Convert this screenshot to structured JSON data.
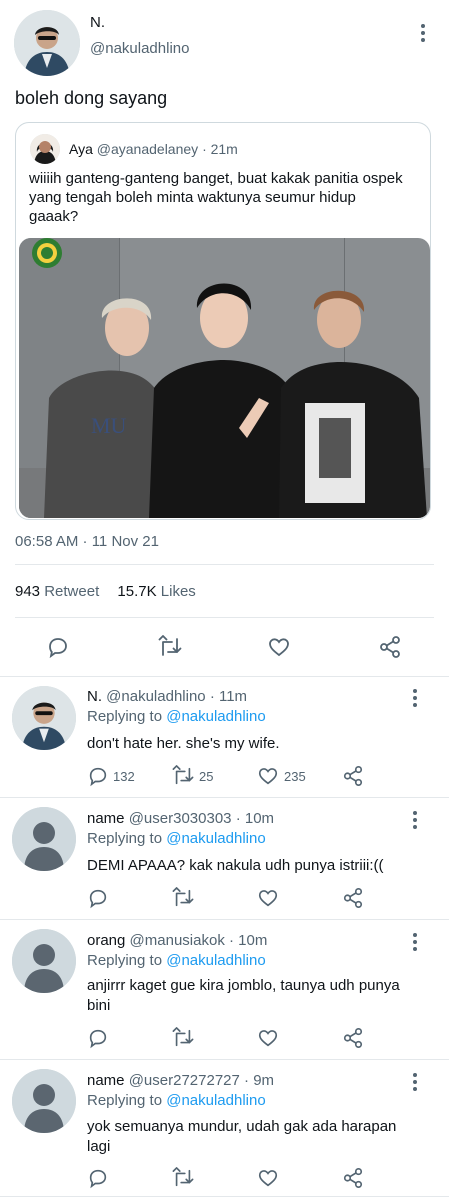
{
  "tweet": {
    "display_name": "N.",
    "handle": "@nakuladhlino",
    "text": "boleh dong sayang",
    "timestamp": "06:58 AM · 11 Nov 21",
    "retweets_count": "943",
    "retweets_label": "Retweet",
    "likes_count": "15.7K",
    "likes_label": "Likes",
    "quote": {
      "display_name": "Aya",
      "handle": "@ayanadelaney",
      "time": "· 21m",
      "text": "wiiiih ganteng-ganteng banget, buat kakak panitia ospek yang tengah boleh minta waktunya seumur hidup gaaak?"
    }
  },
  "replies": [
    {
      "display_name": "N.",
      "handle": "@nakuladhlino",
      "time": "· 11m",
      "replying_label": "Replying to",
      "replying_to": "@nakuladhlino",
      "text": "don't hate her. she's my wife.",
      "reply_count": "132",
      "retweet_count": "25",
      "like_count": "235"
    },
    {
      "display_name": "name",
      "handle": "@user3030303",
      "time": "· 10m",
      "replying_label": "Replying to",
      "replying_to": "@nakuladhlino",
      "text": "DEMI APAAA? kak nakula udh punya istriii:(("
    },
    {
      "display_name": "orang",
      "handle": "@manusiakok",
      "time": "· 10m",
      "replying_label": "Replying to",
      "replying_to": "@nakuladhlino",
      "text": "anjirrr kaget gue kira jomblo, taunya udh punya bini"
    },
    {
      "display_name": "name",
      "handle": "@user27272727",
      "time": "· 9m",
      "replying_label": "Replying to",
      "replying_to": "@nakuladhlino",
      "text": "yok semuanya mundur, udah gak ada harapan lagi"
    }
  ],
  "colors": {
    "accent": "#1d9bf0",
    "secondary_text": "#536471",
    "icon": "#536471",
    "divider": "#e4e8eb"
  },
  "icons": [
    "reply-icon",
    "retweet-icon",
    "like-icon",
    "share-icon",
    "more-icon"
  ]
}
